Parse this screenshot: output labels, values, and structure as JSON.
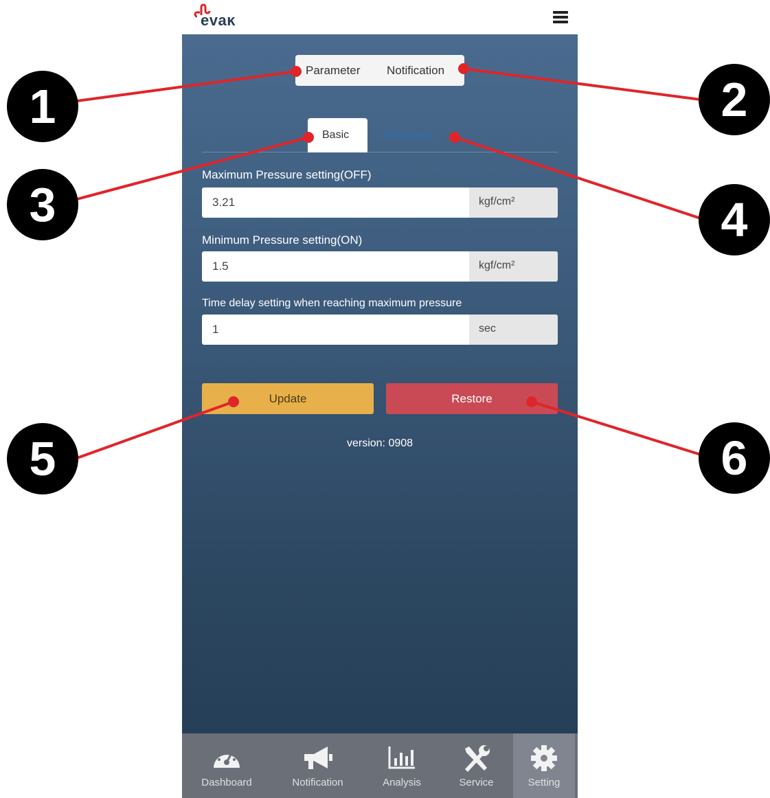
{
  "header": {
    "logo_text": "evaĸ",
    "menu_icon": "hamburger-menu-icon"
  },
  "top_tabs": {
    "parameter": "Parameter",
    "notification": "Notification"
  },
  "sub_tabs": {
    "basic": "Basic",
    "advanced": "Advanced"
  },
  "fields": [
    {
      "label": "Maximum Pressure setting(OFF)",
      "value": "3.21",
      "unit": "kgf/cm²"
    },
    {
      "label": "Minimum Pressure setting(ON)",
      "value": "1.5",
      "unit": "kgf/cm²"
    },
    {
      "label": "Time delay setting when reaching maximum pressure",
      "value": "1",
      "unit": "sec"
    }
  ],
  "buttons": {
    "update": "Update",
    "restore": "Restore"
  },
  "version": "version: 0908",
  "nav": [
    {
      "label": "Dashboard",
      "icon": "gauge-icon"
    },
    {
      "label": "Notification",
      "icon": "megaphone-icon"
    },
    {
      "label": "Analysis",
      "icon": "bar-chart-icon"
    },
    {
      "label": "Service",
      "icon": "tools-icon"
    },
    {
      "label": "Setting",
      "icon": "gear-icon"
    }
  ],
  "callouts": [
    "1",
    "2",
    "3",
    "4",
    "5",
    "6"
  ],
  "colors": {
    "accent_red": "#e0252a",
    "update": "#e8b04a",
    "restore": "#c94a55"
  }
}
